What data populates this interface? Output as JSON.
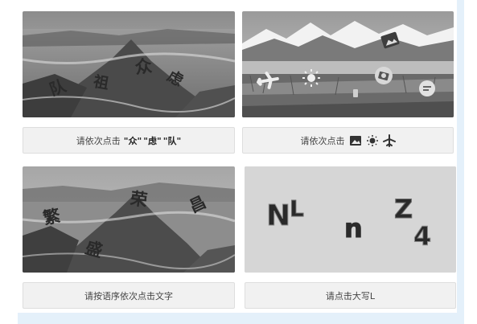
{
  "captchas": [
    {
      "id": "chars",
      "prompt_prefix": "请依次点击",
      "targets": [
        "众",
        "虑",
        "队"
      ],
      "image_chars": [
        "队",
        "祖",
        "众",
        "虑"
      ]
    },
    {
      "id": "icons",
      "prompt_prefix": "请依次点击",
      "target_icons": [
        "image-icon",
        "sun-icon",
        "airplane-icon"
      ],
      "image_icons": [
        "airplane-icon",
        "sun-icon",
        "image-icon",
        "camera-icon",
        "chat-icon",
        "timer-icon"
      ]
    },
    {
      "id": "phrase",
      "prompt": "请按语序依次点击文字",
      "image_chars": [
        "繁",
        "荣",
        "昌",
        "盛"
      ]
    },
    {
      "id": "letters",
      "prompt": "请点击大写L",
      "image_chars": [
        "N",
        "L",
        "n",
        "Z",
        "4"
      ]
    }
  ],
  "colors": {
    "frame": "#e4f0fa",
    "prompt_bg": "#f1f1f1",
    "prompt_border": "#dedede",
    "tile_gray": "#d6d6d6"
  }
}
